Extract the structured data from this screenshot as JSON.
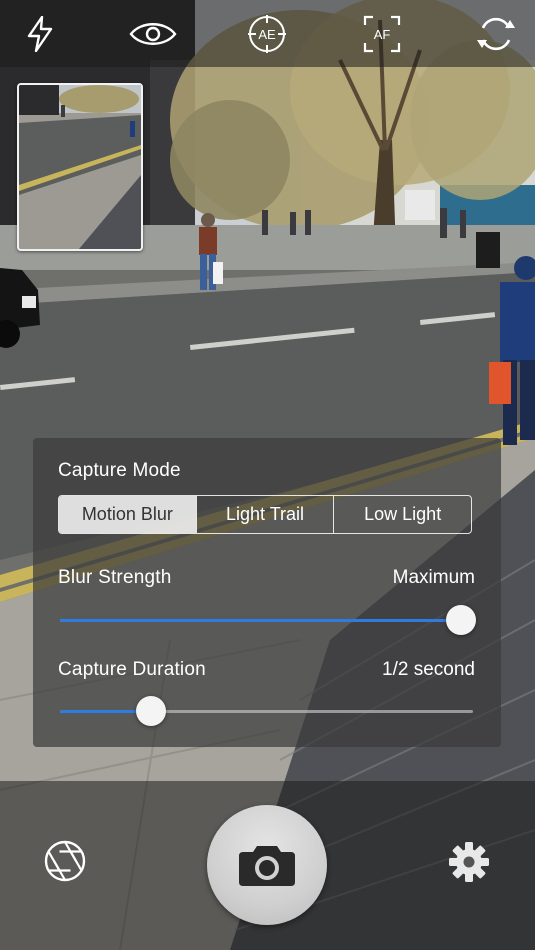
{
  "toolbar": {
    "flash_icon": "lightning-bolt",
    "eye_icon": "eye",
    "ae_label": "AE",
    "af_label": "AF",
    "switch_camera_icon": "rotate-arrows"
  },
  "panel": {
    "capture_mode_label": "Capture Mode",
    "modes": [
      "Motion Blur",
      "Light Trail",
      "Low Light"
    ],
    "selected_mode": "Motion Blur",
    "blur_strength_label": "Blur Strength",
    "blur_strength_value": "Maximum",
    "blur_strength_level": 0.97,
    "capture_duration_label": "Capture Duration",
    "capture_duration_value": "1/2 second",
    "capture_duration_level": 0.22
  },
  "bottom": {
    "aperture_icon": "aperture",
    "shutter_icon": "camera",
    "settings_icon": "gear"
  },
  "colors": {
    "accent": "#2f7be0",
    "panel_bg": "rgba(60,60,60,0.72)",
    "bar_bg": "rgba(30,30,30,0.55)"
  }
}
